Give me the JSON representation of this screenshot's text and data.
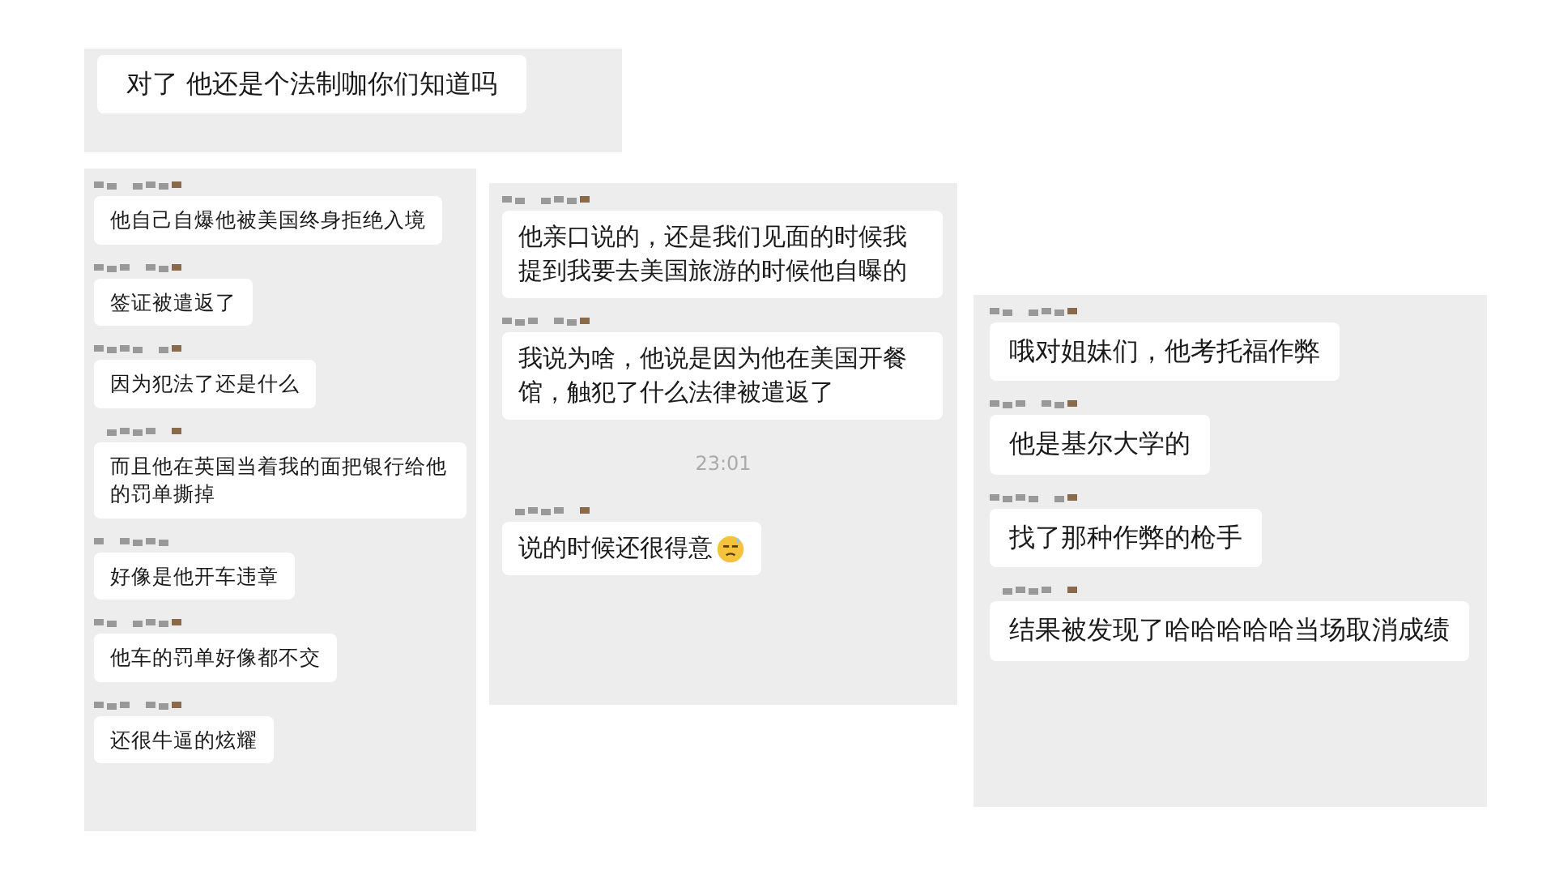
{
  "screenshots": [
    {
      "messages": [
        {
          "kind": "message",
          "text": "对了 他还是个法制咖你们知道吗"
        }
      ]
    },
    {
      "messages": [
        {
          "kind": "message",
          "text": "他自己自爆他被美国终身拒绝入境"
        },
        {
          "kind": "message",
          "text": "签证被遣返了"
        },
        {
          "kind": "message",
          "text": "因为犯法了还是什么"
        },
        {
          "kind": "message",
          "text": "而且他在英国当着我的面把银行给他的罚单撕掉"
        },
        {
          "kind": "message",
          "text": "好像是他开车违章"
        },
        {
          "kind": "message",
          "text": "他车的罚单好像都不交"
        },
        {
          "kind": "message",
          "text": "还很牛逼的炫耀"
        }
      ]
    },
    {
      "messages": [
        {
          "kind": "message",
          "text": "他亲口说的，还是我们见面的时候我提到我要去美国旅游的时候他自曝的"
        },
        {
          "kind": "message",
          "text": "我说为啥，他说是因为他在美国开餐馆，触犯了什么法律被遣返了"
        },
        {
          "kind": "time",
          "text": "23:01"
        },
        {
          "kind": "message",
          "text": "说的时候还很得意",
          "emoji": true
        }
      ]
    },
    {
      "messages": [
        {
          "kind": "message",
          "text": "哦对姐妹们，他考托福作弊"
        },
        {
          "kind": "message",
          "text": "他是基尔大学的"
        },
        {
          "kind": "message",
          "text": "找了那种作弊的枪手"
        },
        {
          "kind": "message",
          "text": "结果被发现了哈哈哈哈哈当场取消成绩"
        }
      ]
    }
  ]
}
